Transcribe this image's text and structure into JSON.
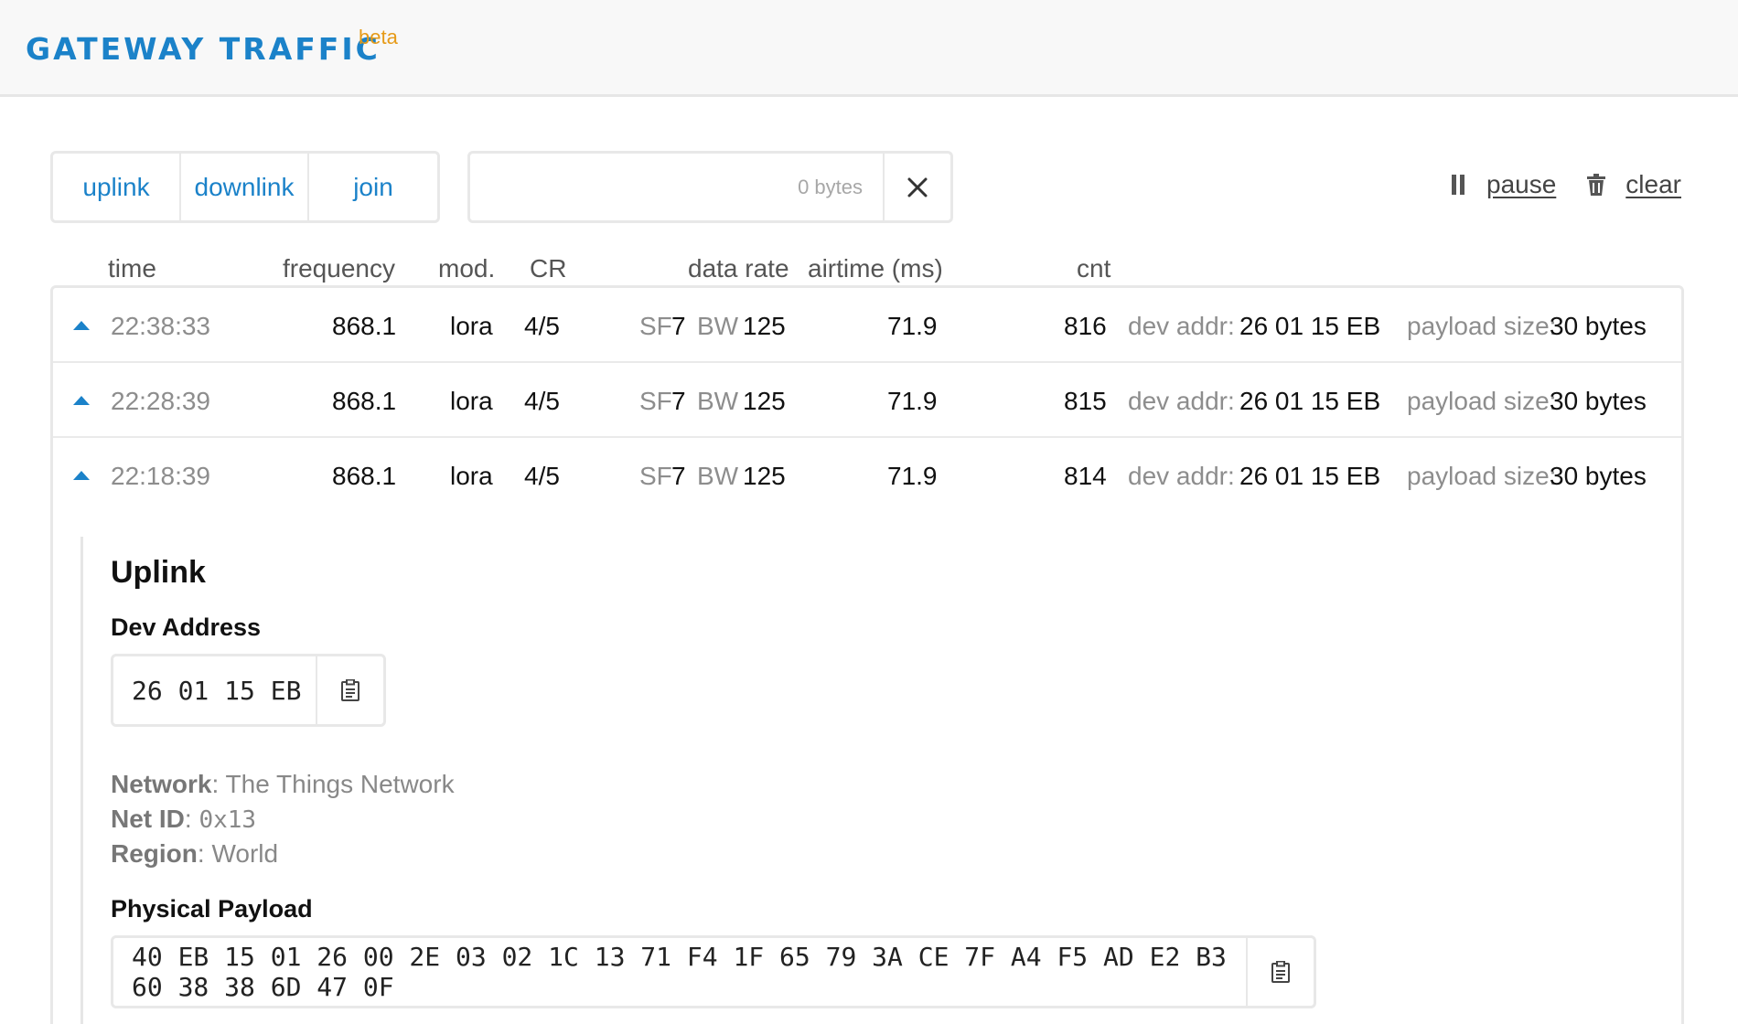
{
  "header": {
    "title": "GATEWAY TRAFFIC",
    "badge": "beta"
  },
  "filters": [
    {
      "label": "uplink"
    },
    {
      "label": "downlink"
    },
    {
      "label": "join"
    }
  ],
  "search": {
    "value": "",
    "bytes_hint": "0 bytes"
  },
  "actions": {
    "pause_label": "pause",
    "clear_label": "clear"
  },
  "columns": {
    "time": "time",
    "frequency": "frequency",
    "mod": "mod.",
    "cr": "CR",
    "data_rate": "data rate",
    "airtime": "airtime (ms)",
    "cnt": "cnt"
  },
  "rows": [
    {
      "time": "22:38:33",
      "frequency": "868.1",
      "mod": "lora",
      "cr": "4/5",
      "sf_label": "SF",
      "sf": "7",
      "bw_label": "BW",
      "bw": "125",
      "airtime": "71.9",
      "cnt": "816",
      "dev_addr_label": "dev addr:",
      "dev_addr": "26 01 15 EB",
      "payload_label": "payload size:",
      "payload": "30 bytes"
    },
    {
      "time": "22:28:39",
      "frequency": "868.1",
      "mod": "lora",
      "cr": "4/5",
      "sf_label": "SF",
      "sf": "7",
      "bw_label": "BW",
      "bw": "125",
      "airtime": "71.9",
      "cnt": "815",
      "dev_addr_label": "dev addr:",
      "dev_addr": "26 01 15 EB",
      "payload_label": "payload size:",
      "payload": "30 bytes"
    },
    {
      "time": "22:18:39",
      "frequency": "868.1",
      "mod": "lora",
      "cr": "4/5",
      "sf_label": "SF",
      "sf": "7",
      "bw_label": "BW",
      "bw": "125",
      "airtime": "71.9",
      "cnt": "814",
      "dev_addr_label": "dev addr:",
      "dev_addr": "26 01 15 EB",
      "payload_label": "payload size:",
      "payload": "30 bytes"
    }
  ],
  "detail": {
    "title": "Uplink",
    "dev_address_heading": "Dev Address",
    "dev_address": "26 01 15 EB",
    "network_label": "Network",
    "network_value": "The Things Network",
    "net_id_label": "Net ID",
    "net_id_value": "0x13",
    "region_label": "Region",
    "region_value": "World",
    "payload_heading": "Physical Payload",
    "payload_hex": "40 EB 15 01 26 00 2E 03 02 1C 13 71 F4 1F 65 79 3A CE 7F A4 F5 AD E2 B3 60 38 38 6D 47 0F"
  },
  "colors": {
    "accent": "#1b82c9",
    "beta": "#e69a17",
    "muted": "#8d8d8d"
  },
  "icons": [
    "close-icon",
    "pause-icon",
    "trash-icon",
    "clipboard-icon",
    "caret-up-icon"
  ]
}
